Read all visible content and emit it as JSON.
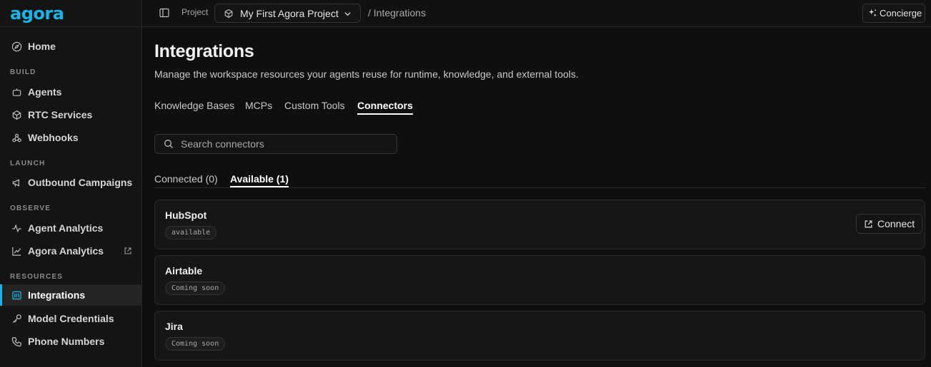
{
  "brand": {
    "logo_text": "agora",
    "accent": "#19b5e6"
  },
  "sidebar": {
    "home": "Home",
    "sections": {
      "build": "BUILD",
      "launch": "LAUNCH",
      "observe": "OBSERVE",
      "resources": "RESOURCES"
    },
    "items": {
      "agents": "Agents",
      "rtc": "RTC Services",
      "webhooks": "Webhooks",
      "outbound": "Outbound Campaigns",
      "agent_analytics": "Agent Analytics",
      "agora_analytics": "Agora Analytics",
      "integrations": "Integrations",
      "model_credentials": "Model Credentials",
      "phone_numbers": "Phone Numbers"
    },
    "active": "integrations"
  },
  "topbar": {
    "project_label": "Project",
    "project_name": "My First Agora Project",
    "breadcrumb": "/ Integrations",
    "concierge": "Concierge"
  },
  "page": {
    "title": "Integrations",
    "description": "Manage the workspace resources your agents reuse for runtime, knowledge, and external tools.",
    "tabs": [
      "Knowledge Bases",
      "MCPs",
      "Custom Tools",
      "Connectors"
    ],
    "active_tab": "Connectors",
    "search_placeholder": "Search connectors",
    "subtabs": [
      "Connected (0)",
      "Available (1)"
    ],
    "active_subtab": "Available (1)"
  },
  "connectors": [
    {
      "name": "HubSpot",
      "status": "available",
      "action": "Connect"
    },
    {
      "name": "Airtable",
      "status": "Coming soon"
    },
    {
      "name": "Jira",
      "status": "Coming soon"
    }
  ]
}
